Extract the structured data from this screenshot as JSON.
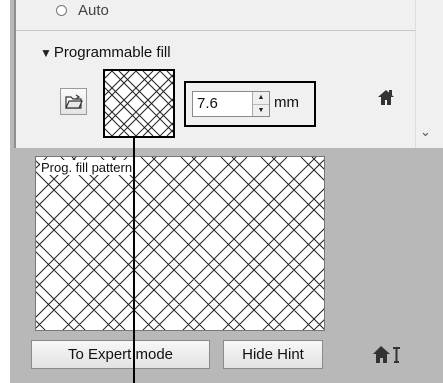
{
  "radio_option": {
    "label": "Auto"
  },
  "section": {
    "title": "Programmable fill"
  },
  "size": {
    "value": "7.6",
    "unit": "mm"
  },
  "hint": {
    "label": "Prog. fill pattern"
  },
  "buttons": {
    "expert": "To Expert mode",
    "hide_hint": "Hide Hint"
  },
  "icons": {
    "open": "folder-open-icon",
    "home": "home-icon",
    "expand": "triangle-down-icon",
    "scroll_down": "chevron-down-icon",
    "hint": "home-with-pin-icon"
  }
}
